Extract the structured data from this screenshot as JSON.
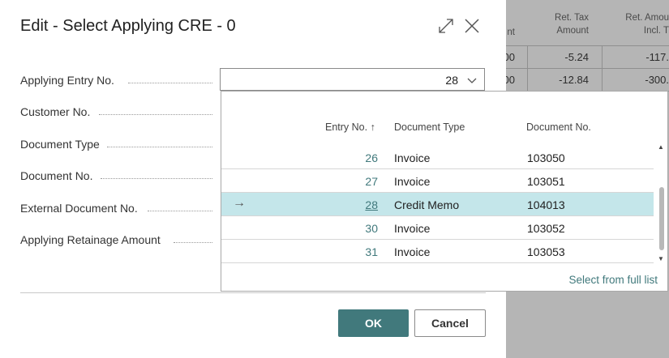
{
  "background_table": {
    "headers": [
      {
        "label": "nt"
      },
      {
        "label": "Ret. Tax\nAmount"
      },
      {
        "label": "Ret. Amou\nIncl. T"
      }
    ],
    "rows": [
      {
        "c0": "00",
        "c1": "-5.24",
        "c2": "-117."
      },
      {
        "c0": "00",
        "c1": "-12.84",
        "c2": "-300."
      }
    ]
  },
  "dialog": {
    "title": "Edit - Select Applying CRE - 0",
    "icons": {
      "expand": "expand-icon",
      "close": "close-icon"
    },
    "fields": [
      {
        "label": "Applying Entry No.",
        "value": "28"
      },
      {
        "label": "Customer No."
      },
      {
        "label": "Document Type"
      },
      {
        "label": "Document No."
      },
      {
        "label": "External Document No."
      },
      {
        "label": "Applying Retainage Amount"
      }
    ],
    "buttons": {
      "ok": "OK",
      "cancel": "Cancel"
    }
  },
  "dropdown": {
    "columns": {
      "entry": "Entry No. ↑",
      "type": "Document Type",
      "docno": "Document No."
    },
    "rows": [
      {
        "entry": "26",
        "type": "Invoice",
        "docno": "103050",
        "selected": false
      },
      {
        "entry": "27",
        "type": "Invoice",
        "docno": "103051",
        "selected": false
      },
      {
        "entry": "28",
        "type": "Credit Memo",
        "docno": "104013",
        "selected": true,
        "marker": "→"
      },
      {
        "entry": "30",
        "type": "Invoice",
        "docno": "103052",
        "selected": false
      },
      {
        "entry": "31",
        "type": "Invoice",
        "docno": "103053",
        "selected": false
      }
    ],
    "footer_link": "Select from full list"
  },
  "colors": {
    "accent": "#41797c",
    "selected_row": "#c4e6ea"
  }
}
